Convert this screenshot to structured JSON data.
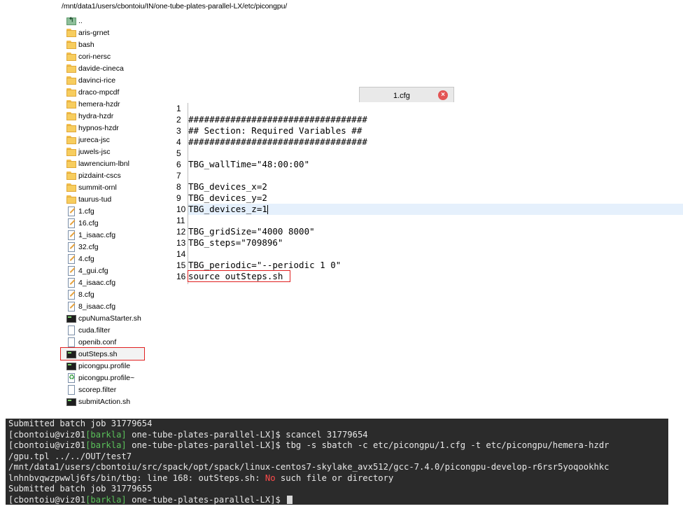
{
  "path": "/mnt/data1/users/cbontoiu/IN/one-tube-plates-parallel-LX/etc/picongpu/",
  "tree": [
    {
      "label": "..",
      "type": "up"
    },
    {
      "label": "aris-grnet",
      "type": "folder"
    },
    {
      "label": "bash",
      "type": "folder"
    },
    {
      "label": "cori-nersc",
      "type": "folder"
    },
    {
      "label": "davide-cineca",
      "type": "folder"
    },
    {
      "label": "davinci-rice",
      "type": "folder"
    },
    {
      "label": "draco-mpcdf",
      "type": "folder"
    },
    {
      "label": "hemera-hzdr",
      "type": "folder"
    },
    {
      "label": "hydra-hzdr",
      "type": "folder"
    },
    {
      "label": "hypnos-hzdr",
      "type": "folder"
    },
    {
      "label": "jureca-jsc",
      "type": "folder"
    },
    {
      "label": "juwels-jsc",
      "type": "folder"
    },
    {
      "label": "lawrencium-lbnl",
      "type": "folder"
    },
    {
      "label": "pizdaint-cscs",
      "type": "folder"
    },
    {
      "label": "summit-ornl",
      "type": "folder"
    },
    {
      "label": "taurus-tud",
      "type": "folder"
    },
    {
      "label": "1.cfg",
      "type": "cfg"
    },
    {
      "label": "16.cfg",
      "type": "cfg"
    },
    {
      "label": "1_isaac.cfg",
      "type": "cfg"
    },
    {
      "label": "32.cfg",
      "type": "cfg"
    },
    {
      "label": "4.cfg",
      "type": "cfg"
    },
    {
      "label": "4_gui.cfg",
      "type": "cfg"
    },
    {
      "label": "4_isaac.cfg",
      "type": "cfg"
    },
    {
      "label": "8.cfg",
      "type": "cfg"
    },
    {
      "label": "8_isaac.cfg",
      "type": "cfg"
    },
    {
      "label": "cpuNumaStarter.sh",
      "type": "sh"
    },
    {
      "label": "cuda.filter",
      "type": "doc"
    },
    {
      "label": "openib.conf",
      "type": "doc"
    },
    {
      "label": "outSteps.sh",
      "type": "sh",
      "selected": true
    },
    {
      "label": "picongpu.profile",
      "type": "sh"
    },
    {
      "label": "picongpu.profile~",
      "type": "recycle"
    },
    {
      "label": "scorep.filter",
      "type": "doc"
    },
    {
      "label": "submitAction.sh",
      "type": "sh"
    }
  ],
  "editor": {
    "tab_label": "1.cfg",
    "close_glyph": "×",
    "lines": [
      "",
      "##################################",
      "## Section: Required Variables ##",
      "##################################",
      "",
      "TBG_wallTime=\"48:00:00\"",
      "",
      "TBG_devices_x=2",
      "TBG_devices_y=2",
      "TBG_devices_z=1",
      "",
      "TBG_gridSize=\"4000 8000\"",
      "TBG_steps=\"709896\"",
      "",
      "TBG_periodic=\"--periodic 1 0\"",
      "source outSteps.sh"
    ],
    "line_numbers": [
      "1",
      "2",
      "3",
      "4",
      "5",
      "6",
      "7",
      "8",
      "9",
      "10",
      "11",
      "12",
      "13",
      "14",
      "15",
      "16"
    ]
  },
  "terminal": {
    "prompt_user": "[cbontoiu@viz01",
    "prompt_host": "[barkla]",
    "prompt_dir": " one-tube-plates-parallel-LX]$ ",
    "line1": "Submitted batch job 31779654",
    "cmd1": "scancel 31779654",
    "cmd2": "tbg -s sbatch -c etc/picongpu/1.cfg -t etc/picongpu/hemera-hzdr",
    "line3": "/gpu.tpl ../../OUT/test7",
    "line4": "/mnt/data1/users/cbontoiu/src/spack/opt/spack/linux-centos7-skylake_avx512/gcc-7.4.0/picongpu-develop-r6rsr5yoqookhkc",
    "line5a": "lnhnbvqwzpwwlj6fs/bin/tbg: line 168: outSteps.sh: ",
    "line5red": "No",
    "line5b": " such file or directory",
    "line6": "Submitted batch job 31779655"
  },
  "colors": {
    "prompt_host": "#5ac15a",
    "error_word": "#ff4b4b",
    "terminal_bg": "#2b2b2b",
    "highlight_box": "#e02020"
  }
}
